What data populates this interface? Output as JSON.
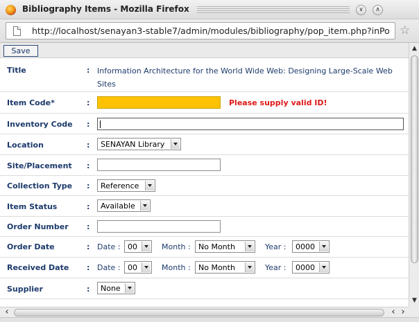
{
  "window": {
    "title": "Bibliography Items - Mozilla Firefox",
    "url": "http://localhost/senayan3-stable7/admin/modules/bibliography/pop_item.php?inPo",
    "icons": {
      "browser": "firefox-logo",
      "page": "page-icon",
      "bookmark": "star-icon",
      "minimize": "chevron-down-icon",
      "maximize": "chevron-up-icon"
    }
  },
  "toolbar": {
    "save_label": "Save"
  },
  "colon": ":",
  "form": {
    "title": {
      "label": "Title",
      "value": "Information Architecture for the World Wide Web: Designing Large-Scale Web Sites"
    },
    "item_code": {
      "label": "Item Code*",
      "value": "",
      "error": "Please supply valid ID!"
    },
    "inventory_code": {
      "label": "Inventory Code",
      "value": ""
    },
    "location": {
      "label": "Location",
      "selected": "SENAYAN Library"
    },
    "site_placement": {
      "label": "Site/Placement",
      "value": ""
    },
    "collection_type": {
      "label": "Collection Type",
      "selected": "Reference"
    },
    "item_status": {
      "label": "Item Status",
      "selected": "Available"
    },
    "order_number": {
      "label": "Order Number",
      "value": ""
    },
    "order_date": {
      "label": "Order Date",
      "date_label": "Date :",
      "date": "00",
      "month_label": "Month :",
      "month": "No Month",
      "year_label": "Year :",
      "year": "0000"
    },
    "received_date": {
      "label": "Received Date",
      "date_label": "Date :",
      "date": "00",
      "month_label": "Month :",
      "month": "No Month",
      "year_label": "Year :",
      "year": "0000"
    },
    "supplier": {
      "label": "Supplier",
      "selected": "None"
    }
  },
  "colors": {
    "label": "#1c3a6b",
    "error": "#e01818",
    "invalid_field": "#ffc200"
  }
}
